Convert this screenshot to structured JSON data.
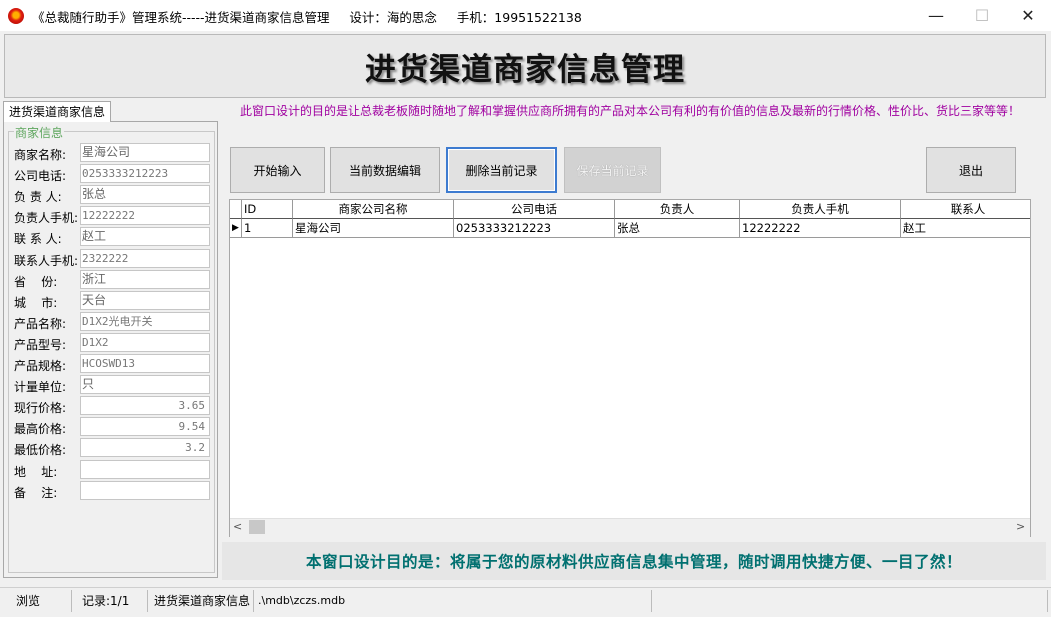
{
  "window": {
    "title": "《总裁随行助手》管理系统-----进货渠道商家信息管理     设计：海的思念     手机：19951522138",
    "min_glyph": "—",
    "max_glyph": "☐",
    "close_glyph": "✕"
  },
  "banner": {
    "title": "进货渠道商家信息管理"
  },
  "tab": {
    "label": "进货渠道商家信息"
  },
  "purpose_text": "此窗口设计的目的是让总裁老板随时随地了解和掌握供应商所拥有的产品对本公司有利的有价值的信息及最新的行情价格、性价比、货比三家等等！",
  "merchant_info": {
    "legend": "商家信息",
    "fields": [
      {
        "label": "商家名称:",
        "value": "星海公司"
      },
      {
        "label": "公司电话:",
        "value": "0253333212223"
      },
      {
        "label": "负 责 人:",
        "value": "张总"
      },
      {
        "label": "负责人手机:",
        "value": "12222222"
      },
      {
        "label": "联 系 人:",
        "value": "赵工"
      },
      {
        "label": "联系人手机:",
        "value": "2322222"
      },
      {
        "label": "省    份:",
        "value": "浙江"
      },
      {
        "label": "城    市:",
        "value": "天台"
      },
      {
        "label": "产品名称:",
        "value": "D1X2光电开关"
      },
      {
        "label": "产品型号:",
        "value": "D1X2"
      },
      {
        "label": "产品规格:",
        "value": "HCOSWD13"
      },
      {
        "label": "计量单位:",
        "value": "只"
      },
      {
        "label": "现行价格:",
        "value": "3.65"
      },
      {
        "label": "最高价格:",
        "value": "9.54"
      },
      {
        "label": "最低价格:",
        "value": "3.2"
      },
      {
        "label": "地    址:",
        "value": ""
      },
      {
        "label": "备    注:",
        "value": ""
      }
    ]
  },
  "toolbar": {
    "start_label": "开始输入",
    "edit_label": "当前数据编辑",
    "delete_label": "删除当前记录",
    "save_label": "保存当前记录",
    "exit_label": "退出"
  },
  "grid": {
    "columns": [
      "ID",
      "商家公司名称",
      "公司电话",
      "负责人",
      "负责人手机",
      "联系人"
    ],
    "rows": [
      {
        "marker": "▶",
        "cells": [
          "1",
          "星海公司",
          "0253333212223",
          "张总",
          "12222222",
          "赵工"
        ]
      }
    ],
    "scroll_left": "<",
    "scroll_right": ">"
  },
  "bottom_message": "本窗口设计目的是：将属于您的原材料供应商信息集中管理，随时调用快捷方便、一目了然！",
  "status_bar": {
    "mode": "浏览",
    "record": "记录:1/1",
    "module": "进货渠道商家信息",
    "db_path": ".\\mdb\\zczs.mdb"
  },
  "colors": {
    "purpose_text": "#a000a0",
    "bottom_message": "#007070",
    "legend": "#5ea65e"
  }
}
